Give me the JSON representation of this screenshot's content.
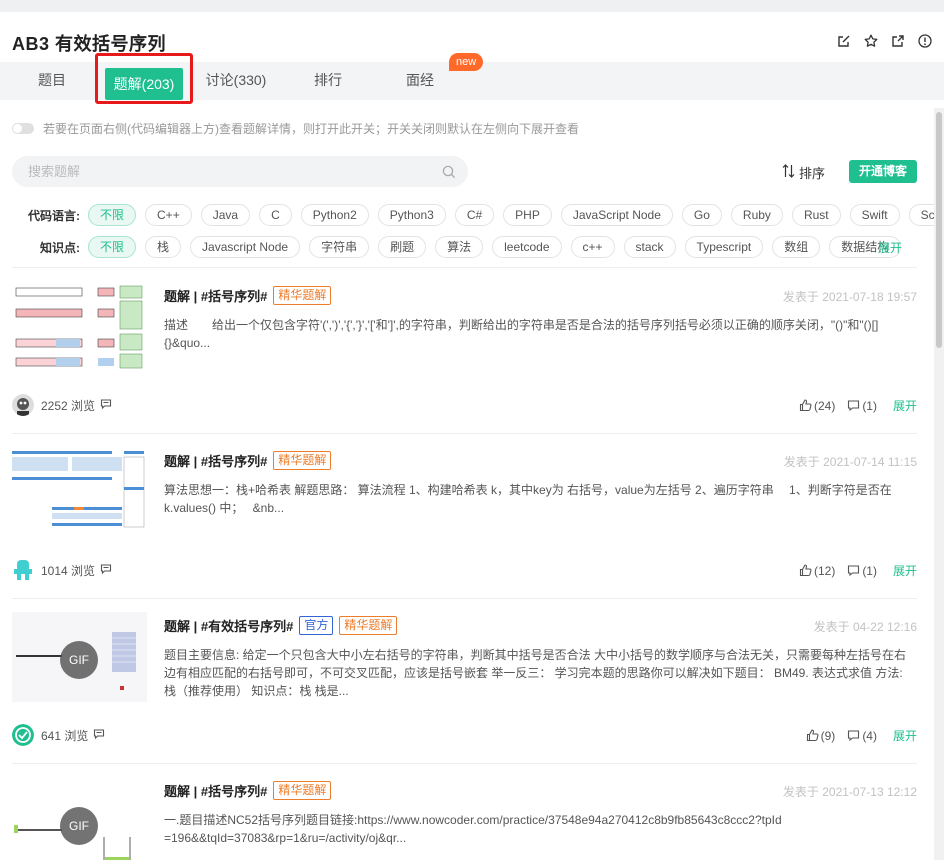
{
  "problem": {
    "title": "AB3  有效括号序列"
  },
  "tabs": [
    {
      "label": "题目"
    },
    {
      "label": "题解(203)"
    },
    {
      "label": "讨论(330)"
    },
    {
      "label": "排行"
    },
    {
      "label": "面经"
    }
  ],
  "new_badge": "new",
  "toggle_text": "若要在页面右侧(代码编辑器上方)查看题解详情，则打开此开关；开关关闭则默认在左侧向下展开查看",
  "search": {
    "placeholder": "搜索题解"
  },
  "sort_label": "排序",
  "blog_button": "开通博客",
  "filters": {
    "languages_label": "代码语言:",
    "languages": [
      "不限",
      "C++",
      "Java",
      "C",
      "Python2",
      "Python3",
      "C#",
      "PHP",
      "JavaScript Node",
      "Go",
      "Ruby",
      "Rust",
      "Swift",
      "Scala"
    ],
    "topics_label": "知识点:",
    "topics": [
      "不限",
      "栈",
      "Javascript Node",
      "字符串",
      "刷题",
      "算法",
      "leetcode",
      "c++",
      "stack",
      "Typescript",
      "数组",
      "数据结构"
    ],
    "expand_label": "展开"
  },
  "items": [
    {
      "title": "题解 | #括号序列#",
      "tags": [
        "精华题解"
      ],
      "date": "发表于 2021-07-18 19:57",
      "desc": "描述　　给出一个仅包含字符'(',')','{','}','['和']',的字符串，判断给出的字符串是否是合法的括号序列括号必须以正确的顺序关闭，\"()\"和\"()[]{}&quo...",
      "views": "2252 浏览",
      "likes": "(24)",
      "comments": "(1)",
      "expand": "展开"
    },
    {
      "title": "题解 | #括号序列#",
      "tags": [
        "精华题解"
      ],
      "date": "发表于 2021-07-14 11:15",
      "desc": "算法思想一：栈+哈希表 解题思路： 算法流程 1、构建哈希表 k，其中key为 右括号，value为左括号 2、遍历字符串　 1、判断字符是否在 k.values() 中；　 &nb...",
      "views": "1014 浏览",
      "likes": "(12)",
      "comments": "(1)",
      "expand": "展开"
    },
    {
      "title": "题解 | #有效括号序列#",
      "tags": [
        "官方",
        "精华题解"
      ],
      "date": "发表于 04-22 12:16",
      "desc": "题目主要信息: 给定一个只包含大中小左右括号的字符串，判断其中括号是否合法 大中小括号的数学顺序与合法无关，只需要每种左括号在右边有相应匹配的右括号即可，不可交叉匹配，应该是括号嵌套 举一反三： 学习完本题的思路你可以解决如下题目： BM49. 表达式求值 方法: 栈（推荐使用） 知识点：栈 栈是...",
      "views": "641 浏览",
      "likes": "(9)",
      "comments": "(4)",
      "expand": "展开",
      "gif": "GIF"
    },
    {
      "title": "题解 | #括号序列#",
      "tags": [
        "精华题解"
      ],
      "date": "发表于 2021-07-13 12:12",
      "desc": "一.题目描述NC52括号序列题目链接:https://www.nowcoder.com/practice/37548e94a270412c8b9fb85643c8ccc2?tpId=196&&tqId=37083&rp=1&ru=/activity/oj&qr...",
      "gif": "GIF"
    }
  ]
}
